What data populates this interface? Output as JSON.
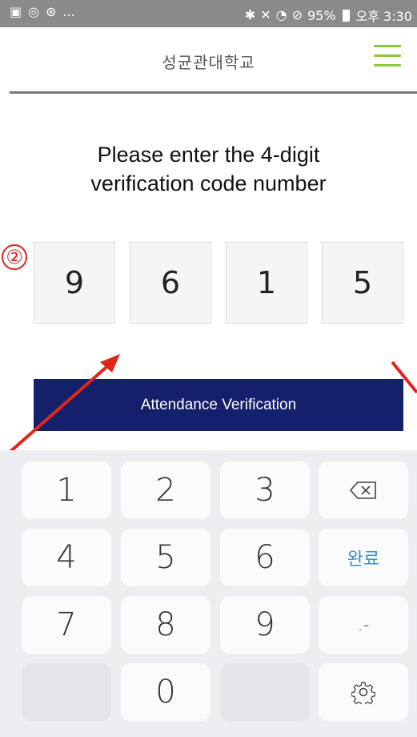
{
  "status_bar": {
    "left_icons": [
      "image-icon",
      "circle-icon",
      "app-icon"
    ],
    "left_more": "...",
    "right_icons": [
      "bluetooth-icon",
      "mute-icon",
      "wifi-icon",
      "no-entry-icon"
    ],
    "battery": "95%",
    "time": "오후 3:30"
  },
  "header": {
    "title": "성균관대학교",
    "menu_icon": "hamburger-menu-icon",
    "accent_color": "#8dc63f"
  },
  "prompt": {
    "line1": "Please enter the 4-digit",
    "line2": "verification code number"
  },
  "code": {
    "digits": [
      "9",
      "6",
      "1",
      "5"
    ]
  },
  "annotation": {
    "step_number": "②",
    "color": "#e0251b"
  },
  "verify_button": {
    "label": "Attendance Verification",
    "color": "#14206c"
  },
  "keyboard": {
    "rows": [
      [
        "1",
        "2",
        "3",
        "backspace-icon"
      ],
      [
        "4",
        "5",
        "6",
        "완료"
      ],
      [
        "7",
        "8",
        "9",
        ".-"
      ],
      [
        "",
        "0",
        "",
        "settings-icon"
      ]
    ],
    "done_label": "완료",
    "punct_label": ".-"
  }
}
